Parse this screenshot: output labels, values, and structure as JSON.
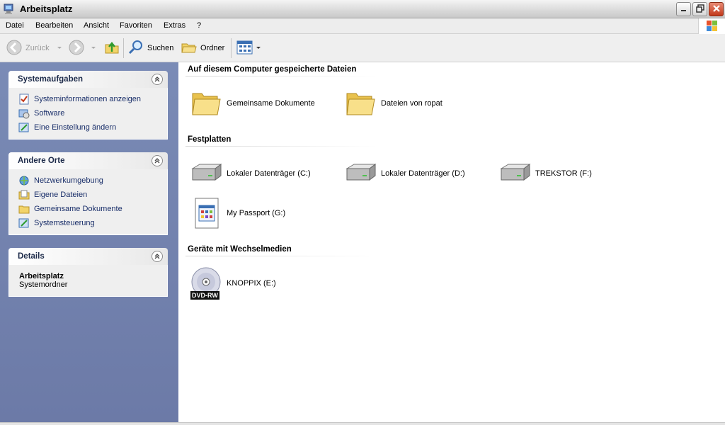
{
  "window": {
    "title": "Arbeitsplatz"
  },
  "menu": {
    "items": [
      "Datei",
      "Bearbeiten",
      "Ansicht",
      "Favoriten",
      "Extras",
      "?"
    ]
  },
  "toolbar": {
    "back_label": "Zurück",
    "search_label": "Suchen",
    "folders_label": "Ordner"
  },
  "sidebar": {
    "system_tasks": {
      "title": "Systemaufgaben",
      "items": [
        "Systeminformationen anzeigen",
        "Software",
        "Eine Einstellung ändern"
      ]
    },
    "other_places": {
      "title": "Andere Orte",
      "items": [
        "Netzwerkumgebung",
        "Eigene Dateien",
        "Gemeinsame Dokumente",
        "Systemsteuerung"
      ]
    },
    "details": {
      "title": "Details",
      "name": "Arbeitsplatz",
      "sub": "Systemordner"
    }
  },
  "content": {
    "groups": [
      {
        "title": "Auf diesem Computer gespeicherte Dateien",
        "items": [
          "Gemeinsame Dokumente",
          "Dateien von ropat"
        ]
      },
      {
        "title": "Festplatten",
        "items": [
          "Lokaler Datenträger (C:)",
          "Lokaler Datenträger (D:)",
          "TREKSTOR (F:)",
          "My Passport (G:)"
        ]
      },
      {
        "title": "Geräte mit Wechselmedien",
        "items": [
          "KNOPPIX (E:)"
        ]
      }
    ],
    "dvd_badge": "DVD-RW"
  },
  "colors": {
    "sidebar_bg": "#7a8bb6",
    "link": "#1a2f6a",
    "close_btn": "#c2391b"
  }
}
